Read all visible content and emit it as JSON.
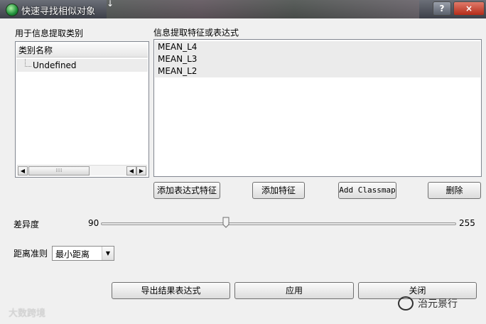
{
  "window": {
    "title": "快速寻找相似对象",
    "help_label": "?",
    "close_label": "×",
    "cursor": "↓"
  },
  "left_panel": {
    "label": "用于信息提取类别",
    "column_header": "类别名称",
    "items": [
      "Undefined"
    ]
  },
  "right_panel": {
    "label": "信息提取特征或表达式",
    "items": [
      "MEAN_L4",
      "MEAN_L3",
      "MEAN_L2"
    ]
  },
  "buttons": {
    "add_expression": "添加表达式特征",
    "add_feature": "添加特征",
    "add_classmap": "Add Classmap",
    "delete": "删除",
    "export_expression": "导出结果表达式",
    "apply": "应用",
    "close": "关闭"
  },
  "slider": {
    "label": "差异度",
    "min_label": "90",
    "max_label": "255"
  },
  "distance": {
    "label": "距离准则",
    "selected": "最小距离"
  },
  "watermarks": {
    "left": "大数跨境",
    "right": "治元景行"
  }
}
